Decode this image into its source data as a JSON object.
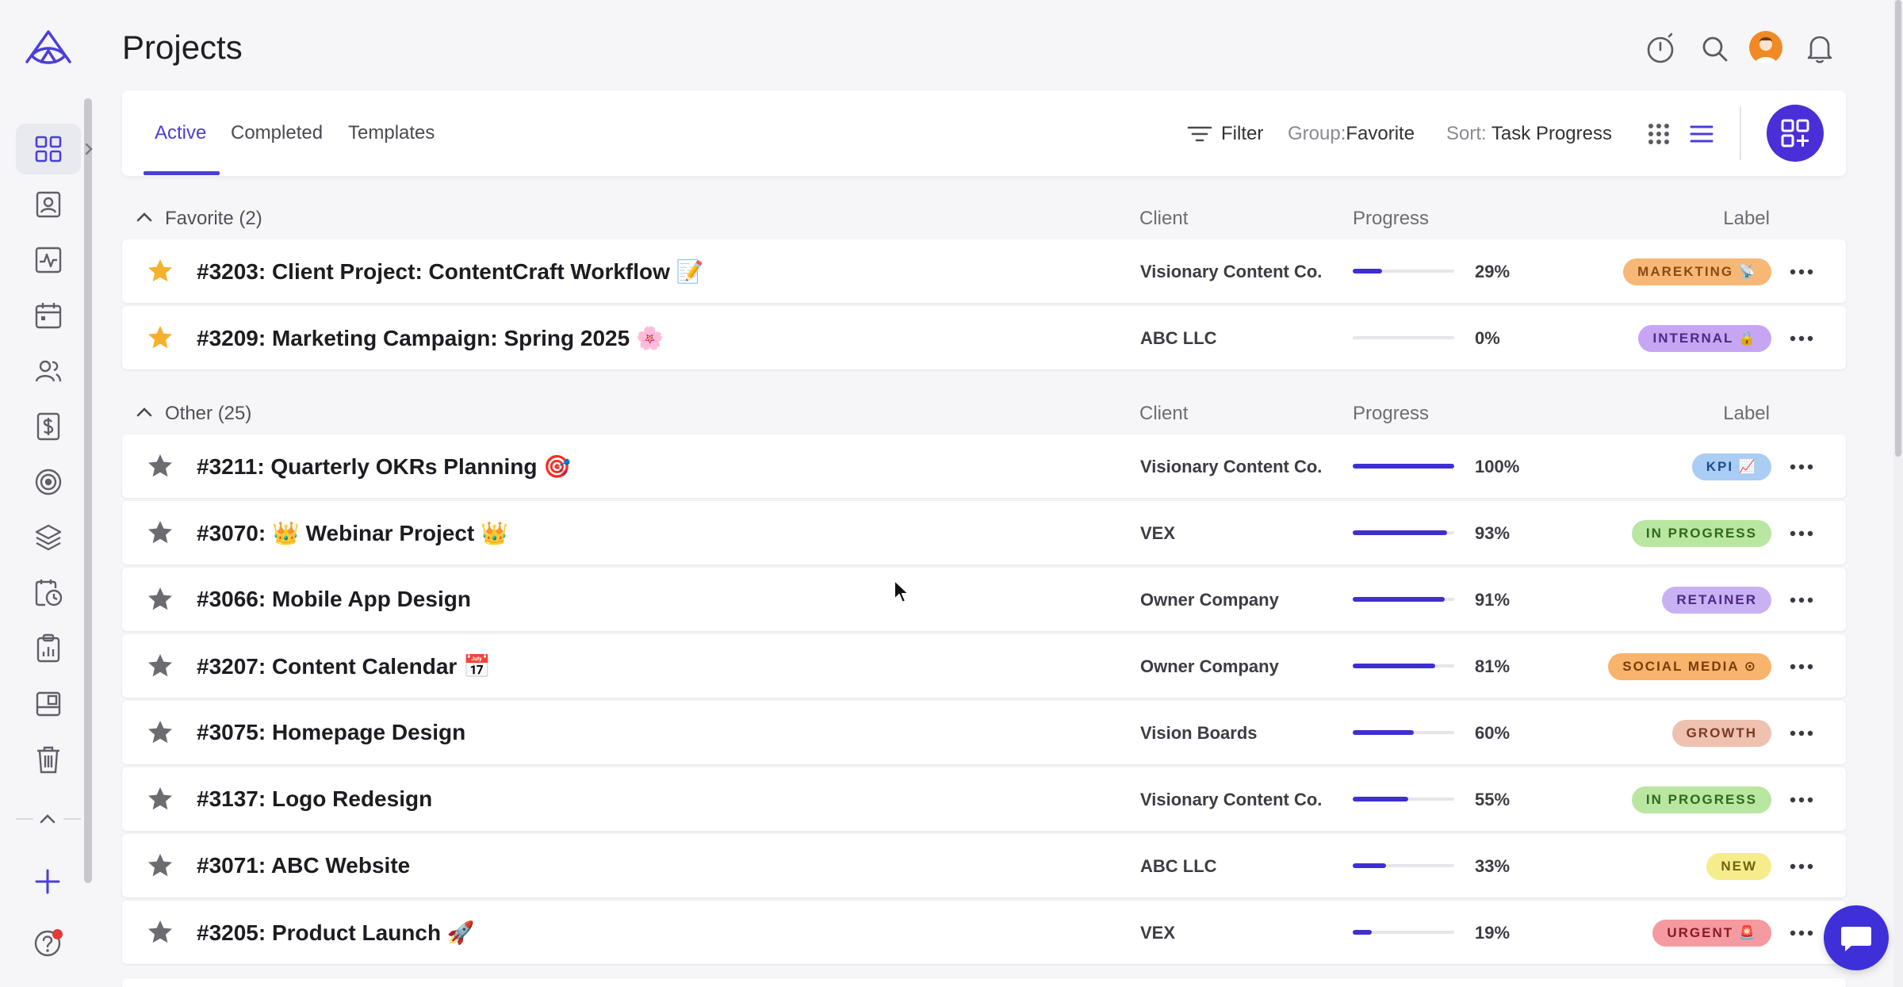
{
  "page": {
    "title": "Projects"
  },
  "sidebar": {
    "items": [
      {
        "icon": "dashboard-grid-icon"
      },
      {
        "icon": "contact-card-icon"
      },
      {
        "icon": "activity-pulse-icon"
      },
      {
        "icon": "calendar-icon"
      },
      {
        "icon": "users-icon"
      },
      {
        "icon": "invoice-dollar-icon"
      },
      {
        "icon": "target-icon"
      },
      {
        "icon": "layers-icon"
      },
      {
        "icon": "timesheet-clock-icon"
      },
      {
        "icon": "reports-clipboard-icon"
      },
      {
        "icon": "templates-icon"
      },
      {
        "icon": "trash-icon"
      }
    ]
  },
  "tabs": [
    {
      "label": "Active",
      "active": true
    },
    {
      "label": "Completed",
      "active": false
    },
    {
      "label": "Templates",
      "active": false
    }
  ],
  "toolbar": {
    "filter_label": "Filter",
    "group_prefix": "Group:",
    "group_value": "Favorite",
    "sort_prefix": "Sort:",
    "sort_value": "Task Progress"
  },
  "columns": {
    "client": "Client",
    "progress": "Progress",
    "label": "Label"
  },
  "groups": {
    "favorite": {
      "title": "Favorite (2)",
      "rows": [
        {
          "name": "#3203: Client Project: ContentCraft Workflow 📝",
          "client": "Visionary Content Co.",
          "progress": 29,
          "progress_text": "29%",
          "label": "MAREKTING 📡",
          "label_bg": "#f7b877",
          "label_fg": "#8a4a12",
          "starred": true
        },
        {
          "name": "#3209: Marketing Campaign: Spring 2025 🌸",
          "client": "ABC LLC",
          "progress": 0,
          "progress_text": "0%",
          "label": "INTERNAL 🔒",
          "label_bg": "#c6a6f2",
          "label_fg": "#4b2a86",
          "starred": true
        }
      ]
    },
    "other": {
      "title": "Other (25)",
      "rows": [
        {
          "name": "#3211: Quarterly OKRs Planning 🎯",
          "client": "Visionary Content Co.",
          "progress": 100,
          "progress_text": "100%",
          "label": "KPI 📈",
          "label_bg": "#a9cdf5",
          "label_fg": "#1d4e88",
          "starred": false
        },
        {
          "name": "#3070: 👑 Webinar Project 👑",
          "client": "VEX",
          "progress": 93,
          "progress_text": "93%",
          "label": "IN PROGRESS",
          "label_bg": "#b9e6a1",
          "label_fg": "#2f6a1b",
          "starred": false
        },
        {
          "name": "#3066: Mobile App Design",
          "client": "Owner Company",
          "progress": 91,
          "progress_text": "91%",
          "label": "RETAINER",
          "label_bg": "#c9b2f3",
          "label_fg": "#4b2a86",
          "starred": false
        },
        {
          "name": "#3207: Content Calendar 📅",
          "client": "Owner Company",
          "progress": 81,
          "progress_text": "81%",
          "label": "SOCIAL MEDIA ⊙",
          "label_bg": "#f8b36c",
          "label_fg": "#7a3c0a",
          "starred": false
        },
        {
          "name": "#3075: Homepage Design",
          "client": "Vision Boards",
          "progress": 60,
          "progress_text": "60%",
          "label": "GROWTH",
          "label_bg": "#eec1b0",
          "label_fg": "#7b3a24",
          "starred": false
        },
        {
          "name": "#3137: Logo Redesign",
          "client": "Visionary Content Co.",
          "progress": 55,
          "progress_text": "55%",
          "label": "IN PROGRESS",
          "label_bg": "#b9e6a1",
          "label_fg": "#2f6a1b",
          "starred": false
        },
        {
          "name": "#3071: ABC Website",
          "client": "ABC LLC",
          "progress": 33,
          "progress_text": "33%",
          "label": "NEW",
          "label_bg": "#f6ec8c",
          "label_fg": "#6e6410",
          "starred": false
        },
        {
          "name": "#3205: Product Launch 🚀",
          "client": "VEX",
          "progress": 19,
          "progress_text": "19%",
          "label": "URGENT 🚨",
          "label_bg": "#f49aa0",
          "label_fg": "#8a1a22",
          "starred": false
        }
      ]
    }
  },
  "colors": {
    "accent": "#4a3fd8",
    "star_gold": "#f5b12c",
    "star_gray": "#6b6b72"
  }
}
